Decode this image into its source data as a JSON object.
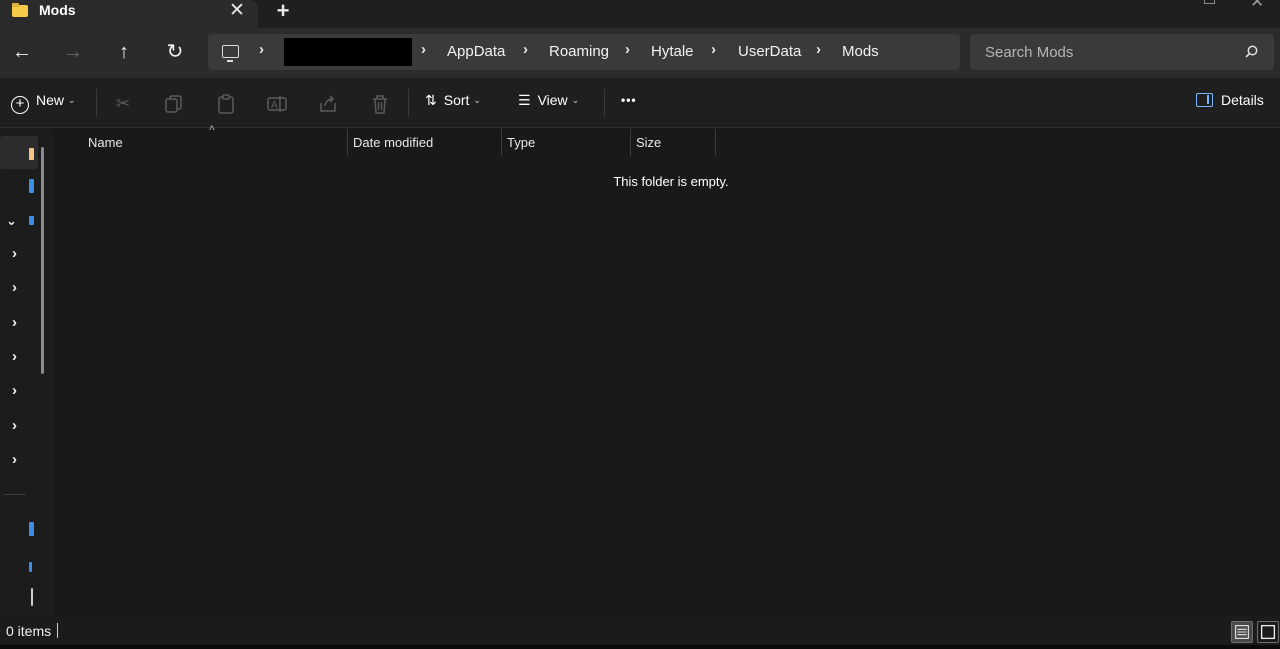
{
  "window": {
    "tab_title": "Mods",
    "tab_close": "✕",
    "new_tab": "+",
    "close_glyph": "✕"
  },
  "nav": {
    "back": "←",
    "forward": "→",
    "up": "↑",
    "refresh": "↻"
  },
  "breadcrumb": {
    "separator": "›",
    "items": [
      "AppData",
      "Roaming",
      "Hytale",
      "UserData",
      "Mods"
    ]
  },
  "search": {
    "placeholder": "Search Mods"
  },
  "toolbar": {
    "new_label": "New",
    "sort_label": "Sort",
    "view_label": "View",
    "more": "•••",
    "details_label": "Details",
    "icons": [
      "cut-icon",
      "copy-icon",
      "paste-icon",
      "rename-icon",
      "share-icon",
      "delete-icon"
    ],
    "details_icon_color": "#79b8ff"
  },
  "columns": [
    {
      "label": "Name"
    },
    {
      "label": "Date modified"
    },
    {
      "label": "Type"
    },
    {
      "label": "Size"
    }
  ],
  "content": {
    "empty_message": "This folder is empty."
  },
  "status": {
    "item_count": "0 items"
  },
  "theme": {
    "background": "#191919",
    "accent": "#4aa3f0",
    "folder": "#f7c948"
  }
}
